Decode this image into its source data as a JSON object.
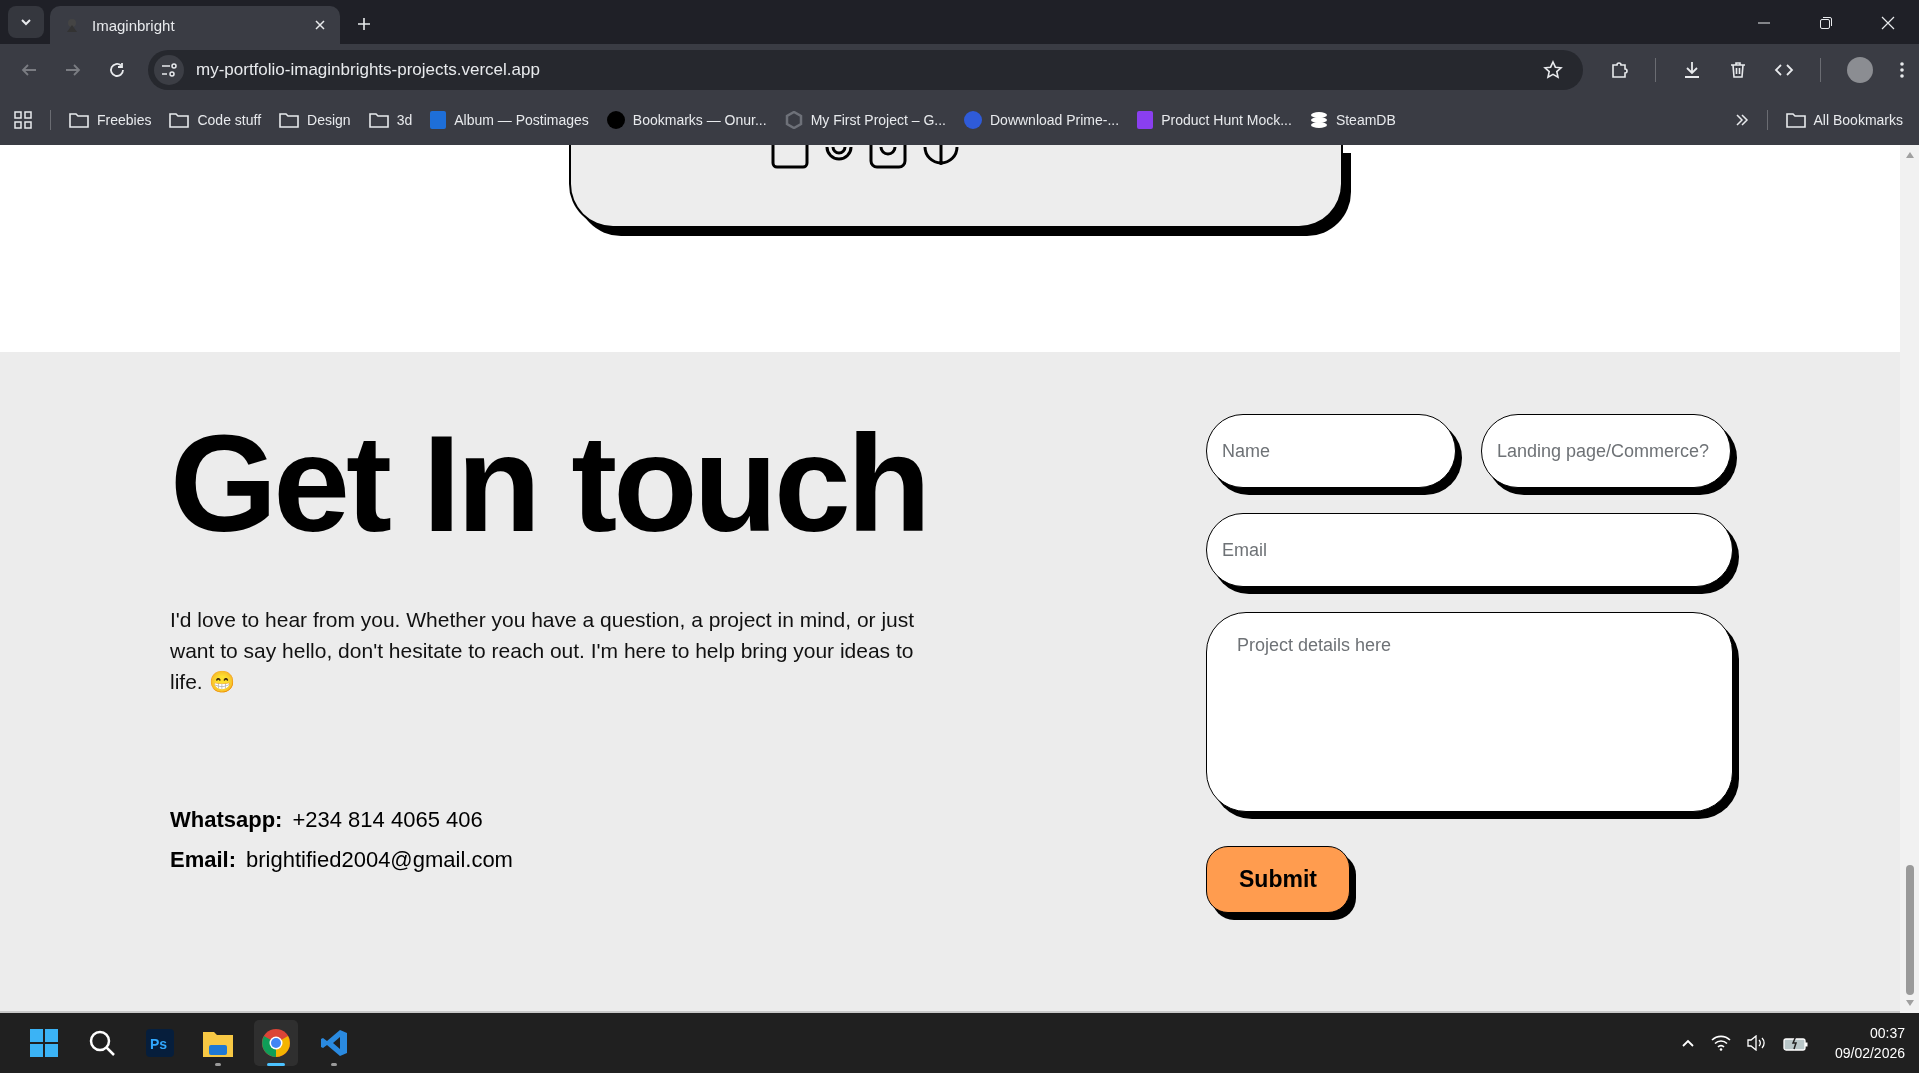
{
  "browser": {
    "tabs": [
      {
        "title": "Imaginbright",
        "selected": true
      }
    ],
    "address": "my-portfolio-imaginbrights-projects.vercel.app",
    "bookmarks": [
      {
        "label": "Freebies",
        "kind": "folder"
      },
      {
        "label": "Code stuff",
        "kind": "folder"
      },
      {
        "label": "Design",
        "kind": "folder"
      },
      {
        "label": "3d",
        "kind": "folder"
      },
      {
        "label": "Album — Postimages",
        "kind": "square",
        "color": "#1e6fd9"
      },
      {
        "label": "Bookmarks — Onur...",
        "kind": "circle",
        "color": "#000000"
      },
      {
        "label": "My First Project – G...",
        "kind": "hexagon",
        "color": "#6e7179"
      },
      {
        "label": "Dowwnload Prime-...",
        "kind": "circle",
        "color": "#2f5bd8"
      },
      {
        "label": "Product Hunt Mock...",
        "kind": "square",
        "color": "#8a3ff0"
      },
      {
        "label": "SteamDB",
        "kind": "stack",
        "color": "#ffffff"
      }
    ],
    "all_bookmarks": "All Bookmarks"
  },
  "contact": {
    "heading": "Get In touch",
    "intro": "I'd love to hear from you. Whether you have a question, a project in mind, or just want to say hello, don't hesitate to reach out. I'm here to help bring your ideas to life. 😁",
    "details": [
      {
        "label": "Whatsapp:",
        "value": "+234 814 4065 406"
      },
      {
        "label": "Email:",
        "value": "brightified2004@gmail.com"
      }
    ],
    "form": {
      "fields": [
        {
          "placeholder": "Name",
          "kind": "short"
        },
        {
          "placeholder": "Landing page/Commerce?",
          "kind": "short"
        },
        {
          "placeholder": "Email",
          "kind": "wide"
        },
        {
          "placeholder": "Project details here",
          "kind": "area"
        }
      ],
      "submit": "Submit"
    }
  },
  "taskbar": {
    "apps": [
      {
        "kind": "start",
        "running": false,
        "selected": false
      },
      {
        "kind": "search",
        "running": false,
        "selected": false
      },
      {
        "kind": "photoshop",
        "label": "Ps",
        "running": false,
        "selected": false
      },
      {
        "kind": "files",
        "running": true,
        "selected": false
      },
      {
        "kind": "chrome",
        "running": true,
        "selected": true
      },
      {
        "kind": "vscode",
        "running": true,
        "selected": false
      }
    ],
    "time": "00:37",
    "date": "09/02/2026"
  }
}
